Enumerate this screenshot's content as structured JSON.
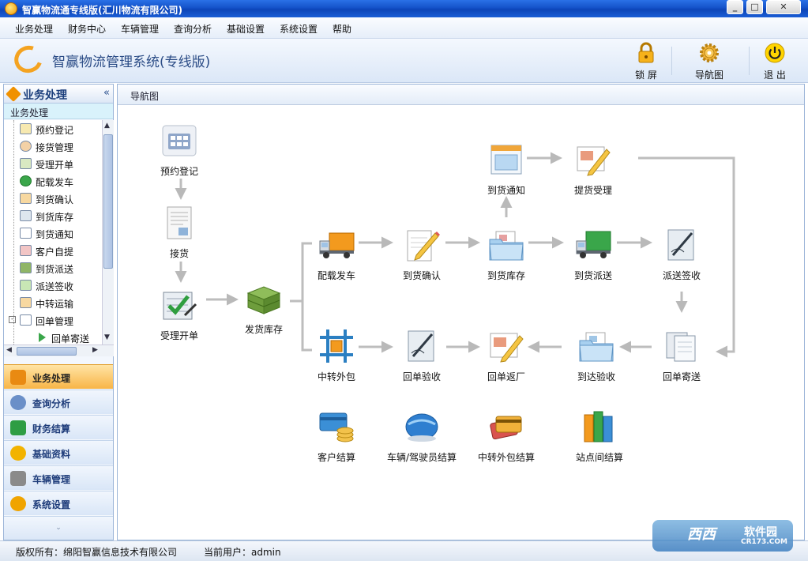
{
  "window": {
    "title": "智赢物流通专线版(汇川物流有限公司)"
  },
  "menu": [
    "业务处理",
    "财务中心",
    "车辆管理",
    "查询分析",
    "基础设置",
    "系统设置",
    "帮助"
  ],
  "header": {
    "logo_text": "智赢物流管理系统(专线版)",
    "tools": [
      {
        "label": "锁 屏",
        "icon": "lock-icon"
      },
      {
        "label": "导航图",
        "icon": "gear-icon"
      },
      {
        "label": "退 出",
        "icon": "power-icon"
      }
    ]
  },
  "left_panel": {
    "title": "业务处理",
    "subtitle": "业务处理",
    "tree": [
      "预约登记",
      "接货管理",
      "受理开单",
      "配载发车",
      "到货确认",
      "到货库存",
      "到货通知",
      "客户自提",
      "到货派送",
      "派送签收",
      "中转运输",
      "回单管理",
      "回单寄送"
    ],
    "nav": [
      {
        "label": "业务处理",
        "active": true,
        "color": "#e98a12"
      },
      {
        "label": "查询分析",
        "active": false,
        "color": "#6a8fc8"
      },
      {
        "label": "财务结算",
        "active": false,
        "color": "#2e9d44"
      },
      {
        "label": "基础资料",
        "active": false,
        "color": "#f2b300"
      },
      {
        "label": "车辆管理",
        "active": false,
        "color": "#8a8a8a"
      },
      {
        "label": "系统设置",
        "active": false,
        "color": "#f0a400"
      }
    ]
  },
  "main": {
    "tab": "导航图",
    "nodes": {
      "yuyue": "预约登记",
      "jiehuo": "接货",
      "shouli": "受理开单",
      "fahuo_kucun": "发货库存",
      "peizai": "配载发车",
      "daohuo_queren": "到货确认",
      "daohuo_kucun": "到货库存",
      "daohuo_tongzhi": "到货通知",
      "tihuo_shouli": "提货受理",
      "daohuo_paisong": "到货派送",
      "paisong_qianshou": "派送签收",
      "zhongzhuan_waibao": "中转外包",
      "huidan_yanshou": "回单验收",
      "huidan_fanchang": "回单返厂",
      "daoda_yanshou": "到达验收",
      "huidan_jisong": "回单寄送",
      "kehu_jiesuan": "客户结算",
      "cheliang_jiesuan": "车辆/驾驶员结算",
      "zhongzhuan_jiesuan": "中转外包结算",
      "zhandian_jiesuan": "站点间结算"
    }
  },
  "status": {
    "copyright": "版权所有：绵阳智赢信息技术有限公司",
    "user": "当前用户：admin"
  },
  "watermark": {
    "brand": "西西",
    "text": "软件园",
    "url": "CR173.COM"
  }
}
